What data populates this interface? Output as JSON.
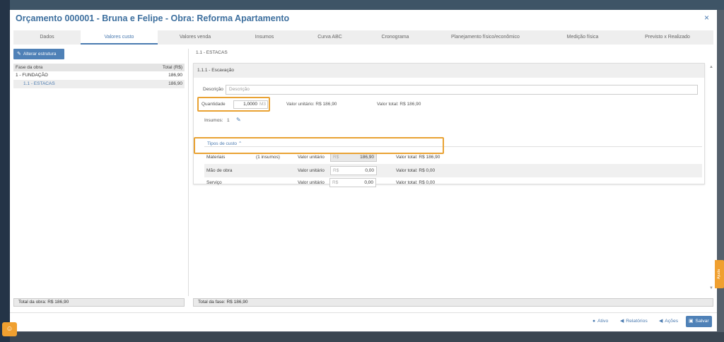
{
  "modal": {
    "title": "Orçamento 000001 - Bruna e Felipe - Obra: Reforma Apartamento",
    "close_icon": "×"
  },
  "tabs": [
    {
      "label": "Dados",
      "active": false
    },
    {
      "label": "Valores custo",
      "active": true
    },
    {
      "label": "Valores venda",
      "active": false
    },
    {
      "label": "Insumos",
      "active": false
    },
    {
      "label": "Curva ABC",
      "active": false
    },
    {
      "label": "Cronograma",
      "active": false
    },
    {
      "label": "Planejamento físico/econômico",
      "active": false
    },
    {
      "label": "Medição física",
      "active": false
    },
    {
      "label": "Previsto x Realizado",
      "active": false
    }
  ],
  "left_panel": {
    "alter_button": "Alterar estrutura",
    "header": {
      "col1": "Fase da obra",
      "col2": "Total (R$)"
    },
    "rows": [
      {
        "label": "1 - FUNDAÇÃO",
        "value": "186,90"
      },
      {
        "label": "1.1 - ESTACAS",
        "value": "186,90"
      }
    ],
    "total": "Total da obra: R$ 186,90"
  },
  "right_panel": {
    "breadcrumb": "1.1 - ESTACAS",
    "section_title": "1.1.1 - Escavação",
    "descricao_label": "Descrição",
    "descricao_placeholder": "Descrição",
    "quantidade_label": "Quantidade",
    "quantidade_value": "1,0000",
    "quantidade_unit": "M3",
    "valor_unitario": "Valor unitário: R$ 186,90",
    "valor_total": "Valor total: R$ 186,90",
    "insumos_label": "Insumos:",
    "insumos_count": "1",
    "tipos_label": "Tipos de custo",
    "tipos_chevron": "⌃",
    "cost_rows": [
      {
        "name": "Materiais",
        "insumos": "(1 insumos)",
        "vu_label": "Valor unitário",
        "currency": "R$",
        "value": "186,90",
        "total": "Valor total: R$ 186,90"
      },
      {
        "name": "Mão de obra",
        "insumos": "",
        "vu_label": "Valor unitário",
        "currency": "R$",
        "value": "0,00",
        "total": "Valor total: R$ 0,00"
      },
      {
        "name": "Serviço",
        "insumos": "",
        "vu_label": "Valor unitário",
        "currency": "R$",
        "value": "0,00",
        "total": "Valor total: R$ 0,00"
      }
    ],
    "total": "Total da fase: R$ 186,90"
  },
  "footer": {
    "ativo": "Ativo",
    "relatorios": "Relatórios",
    "acoes": "Ações",
    "salvar": "Salvar"
  },
  "side": {
    "ajuda": "Ajuda"
  },
  "colors": {
    "accent": "#4a7ab0",
    "highlight": "#e9a233",
    "button": "#4f81b7"
  }
}
